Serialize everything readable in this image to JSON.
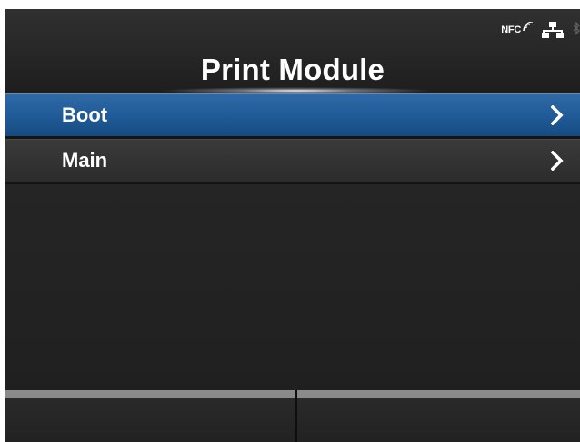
{
  "header": {
    "title": "Print Module",
    "status_icons": {
      "nfc_label": "NFC",
      "network_icon": "wired-network-icon",
      "bluetooth_icon": "bluetooth-icon"
    }
  },
  "menu": {
    "items": [
      {
        "label": "Boot",
        "selected": true,
        "icon": "chevron-right-icon"
      },
      {
        "label": "Main",
        "selected": false,
        "icon": "chevron-right-icon"
      }
    ]
  },
  "softkeys": {
    "left_label": "",
    "right_label": ""
  },
  "colors": {
    "selected_row": "#1f5a96",
    "background": "#232323",
    "softkey_strip": "#8a8a8a",
    "text": "#ffffff"
  }
}
